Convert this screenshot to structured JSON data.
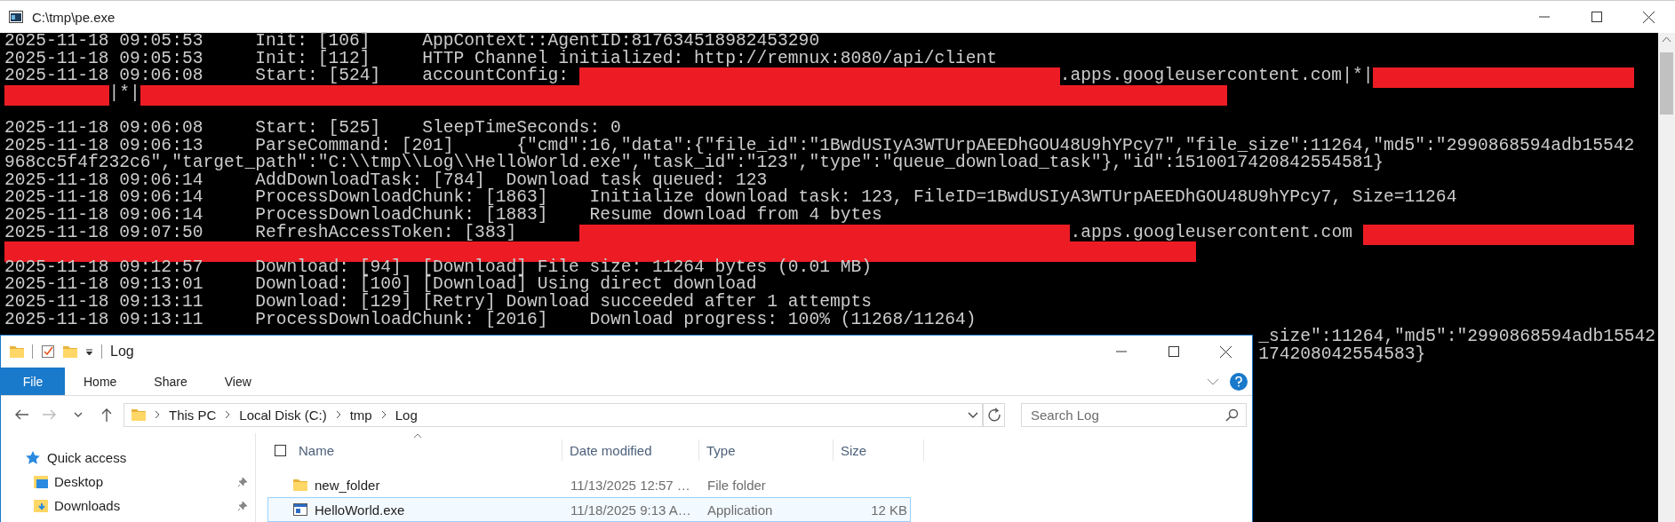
{
  "console": {
    "title": "C:\\tmp\\pe.exe",
    "lines": [
      {
        "kind": "text",
        "segments": [
          {
            "kind": "text",
            "text": "2025-11-18 09:05:53     Init: [106]     AppContext::AgentID:817634518982453290"
          }
        ]
      },
      {
        "kind": "text",
        "segments": [
          {
            "kind": "text",
            "text": "2025-11-18 09:05:53     Init: [112]     HTTP Channel initialized: http://remnux:8080/api/client"
          }
        ]
      },
      {
        "kind": "text",
        "segments": [
          {
            "kind": "text",
            "text": "2025-11-18 09:06:08     Start: [524]    accountConfig: "
          },
          {
            "kind": "redaction"
          },
          {
            "kind": "text",
            "text": ".apps.googleusercontent.com|*|"
          },
          {
            "kind": "redaction"
          }
        ]
      },
      {
        "kind": "text",
        "segments": [
          {
            "kind": "redaction"
          },
          {
            "kind": "text",
            "text": "|*|"
          },
          {
            "kind": "redaction"
          }
        ]
      },
      {
        "kind": "blank"
      },
      {
        "kind": "text",
        "segments": [
          {
            "kind": "text",
            "text": "2025-11-18 09:06:08     Start: [525]    SleepTimeSeconds: 0"
          }
        ]
      },
      {
        "kind": "text",
        "segments": [
          {
            "kind": "text",
            "text": "2025-11-18 09:06:13     ParseCommand: [201]      {\"cmd\":16,\"data\":{\"file_id\":\"1BwdUSIyA3WTUrpAEEDhGOU48U9hYPcy7\",\"file_size\":11264,\"md5\":\"2990868594adb15542"
          }
        ]
      },
      {
        "kind": "text",
        "segments": [
          {
            "kind": "text",
            "text": "968cc5f4f232c6\",\"target_path\":\"C:\\\\tmp\\\\Log\\\\HelloWorld.exe\",\"task_id\":\"123\",\"type\":\"queue_download_task\"},\"id\":1510017420842554581}"
          }
        ]
      },
      {
        "kind": "text",
        "segments": [
          {
            "kind": "text",
            "text": "2025-11-18 09:06:14     AddDownloadTask: [784]  Download task queued: 123"
          }
        ]
      },
      {
        "kind": "text",
        "segments": [
          {
            "kind": "text",
            "text": "2025-11-18 09:06:14     ProcessDownloadChunk: [1863]    Initialize download task: 123, FileID=1BwdUSIyA3WTUrpAEEDhGOU48U9hYPcy7, Size=11264"
          }
        ]
      },
      {
        "kind": "text",
        "segments": [
          {
            "kind": "text",
            "text": "2025-11-18 09:06:14     ProcessDownloadChunk: [1883]    Resume download from 4 bytes"
          }
        ]
      },
      {
        "kind": "text",
        "segments": [
          {
            "kind": "text",
            "text": "2025-11-18 09:07:50     RefreshAccessToken: [383]      "
          },
          {
            "kind": "redaction"
          },
          {
            "kind": "text",
            "text": ".apps.googleusercontent.com "
          },
          {
            "kind": "redaction"
          }
        ]
      },
      {
        "kind": "text",
        "segments": [
          {
            "kind": "redaction"
          }
        ]
      },
      {
        "kind": "text",
        "segments": [
          {
            "kind": "text",
            "text": "2025-11-18 09:12:57     Download: [94]  [Download] File size: 11264 bytes (0.01 MB)"
          }
        ]
      },
      {
        "kind": "text",
        "segments": [
          {
            "kind": "text",
            "text": "2025-11-18 09:13:01     Download: [100] [Download] Using direct download"
          }
        ]
      },
      {
        "kind": "text",
        "segments": [
          {
            "kind": "text",
            "text": "2025-11-18 09:13:11     Download: [129] [Retry] Download succeeded after 1 attempts"
          }
        ]
      },
      {
        "kind": "text",
        "segments": [
          {
            "kind": "text",
            "text": "2025-11-18 09:13:11     ProcessDownloadChunk: [2016]    Download progress: 100% (11268/11264)"
          }
        ]
      },
      {
        "kind": "text",
        "segments": [
          {
            "kind": "text",
            "text": "_size\":11264,\"md5\":\"2990868594adb15542"
          }
        ]
      },
      {
        "kind": "text",
        "segments": [
          {
            "kind": "text",
            "text": "174208042554583}"
          }
        ]
      }
    ]
  },
  "explorer": {
    "title": "Log",
    "ribbon_tabs": [
      {
        "label": "File",
        "kind": "menu"
      },
      {
        "label": "Home",
        "kind": "tab"
      },
      {
        "label": "Share",
        "kind": "tab"
      },
      {
        "label": "View",
        "kind": "tab"
      }
    ],
    "address": [
      "This PC",
      "Local Disk (C:)",
      "tmp",
      "Log"
    ],
    "search": {
      "placeholder": "Search Log"
    },
    "nav": [
      {
        "label": "Quick access",
        "kind": "star",
        "pinned": false
      },
      {
        "label": "Desktop",
        "kind": "desktop",
        "pinned": true
      },
      {
        "label": "Downloads",
        "kind": "downloads",
        "pinned": true
      }
    ],
    "select_all": {
      "checked": false
    },
    "columns": [
      "Name",
      "Date modified",
      "Type",
      "Size"
    ],
    "rows": [
      {
        "name": "new_folder",
        "kind": "folder",
        "date": "11/13/2025 12:57 …",
        "type": "File folder",
        "selected": false
      },
      {
        "name": "HelloWorld.exe",
        "kind": "app",
        "date": "11/18/2025 9:13 A…",
        "type": "Application",
        "size": "12 KB",
        "selected": true
      }
    ]
  }
}
